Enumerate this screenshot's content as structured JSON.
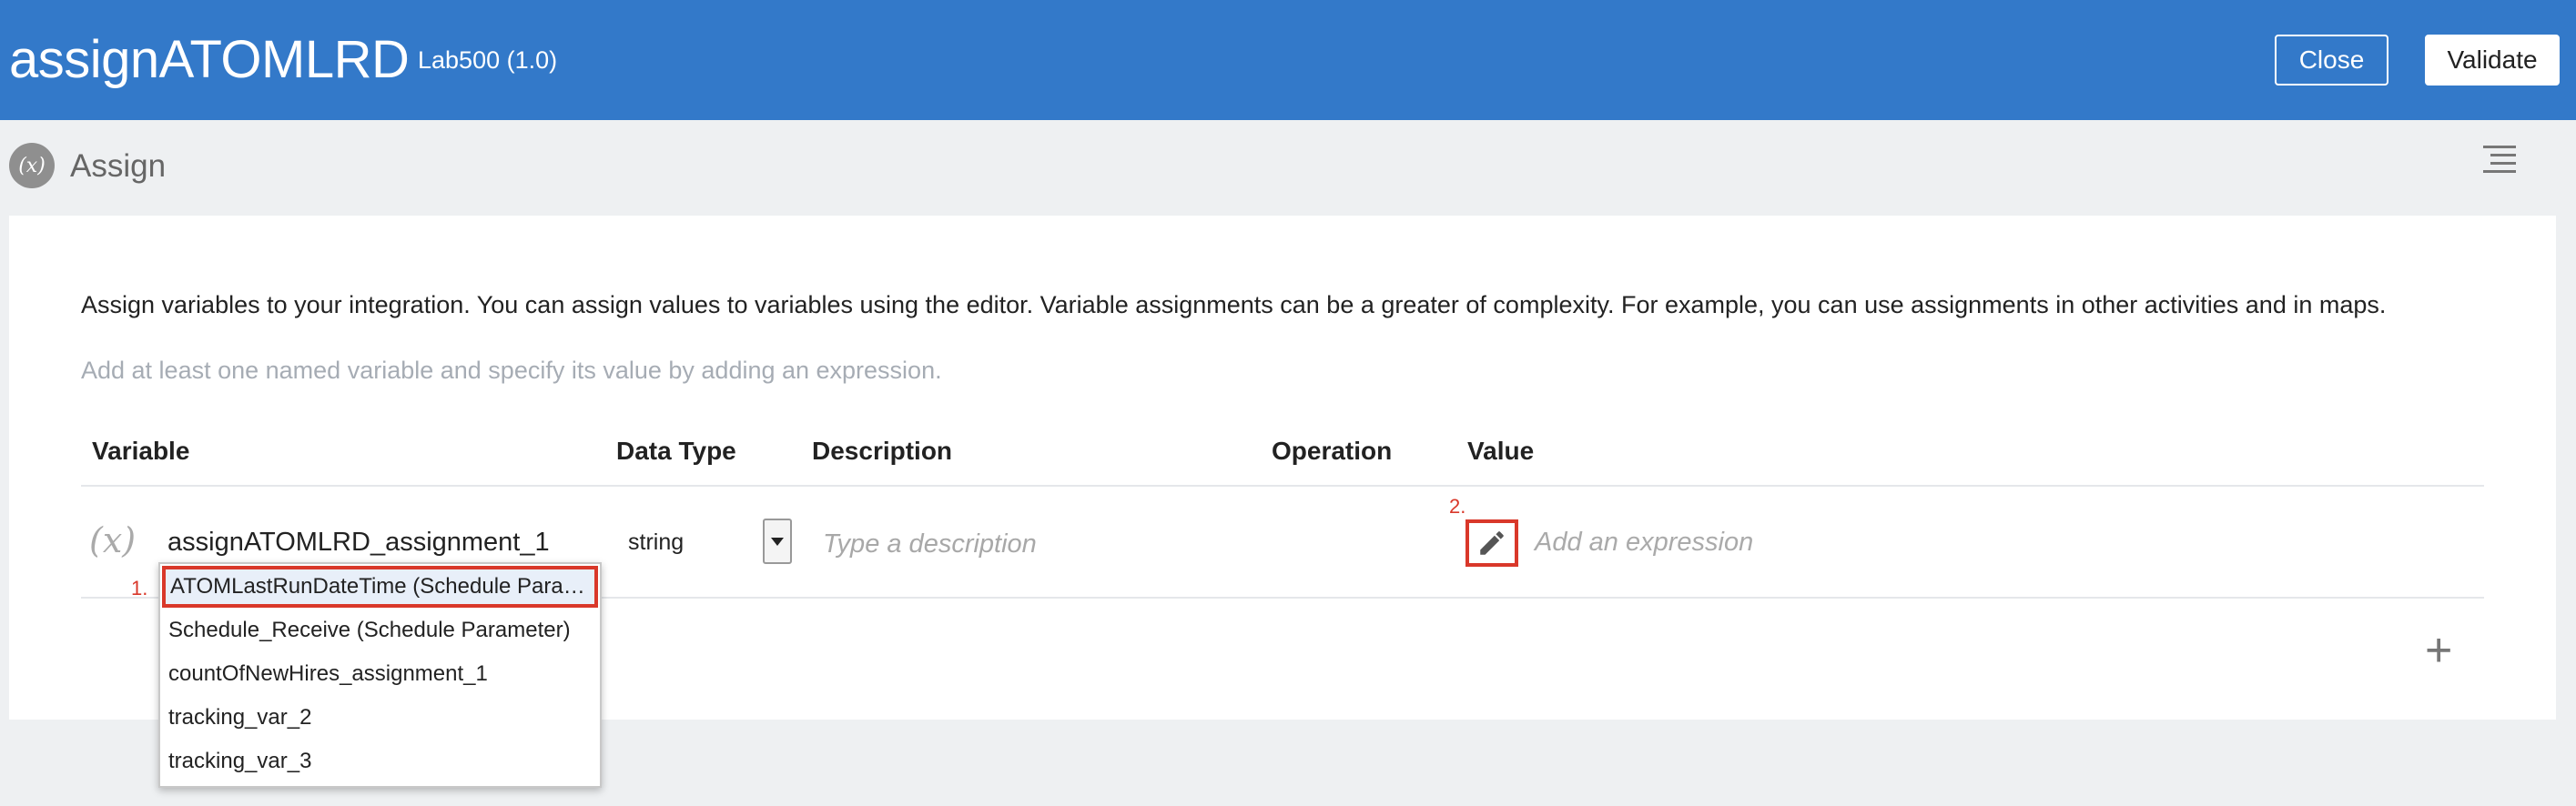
{
  "header": {
    "title": "assignATOMLRD",
    "subtitle": "Lab500 (1.0)",
    "close_label": "Close",
    "validate_label": "Validate",
    "bg_color": "#3379c9"
  },
  "subheader": {
    "icon_text": "(x)",
    "label": "Assign"
  },
  "intro": {
    "text": "Assign variables to your integration. You can assign values to variables using the editor. Variable assignments can be a greater of complexity. For example, you can use assignments in other activities and in maps.",
    "hint": "Add at least one named variable and specify its value by adding an expression."
  },
  "table": {
    "columns": [
      "Variable",
      "Data Type",
      "Description",
      "Operation",
      "Value"
    ],
    "row": {
      "icon_text": "(x)",
      "variable": "assignATOMLRD_assignment_1",
      "data_type": "string",
      "description_placeholder": "Type a description",
      "value_placeholder": "Add an expression"
    }
  },
  "dropdown": {
    "items": [
      "ATOMLastRunDateTime (Schedule Parameter)",
      "Schedule_Receive (Schedule Parameter)",
      "countOfNewHires_assignment_1",
      "tracking_var_2",
      "tracking_var_3"
    ],
    "selected_index": 0
  },
  "annotations": {
    "mark1": "1.",
    "mark2": "2.",
    "color": "#d9382a"
  },
  "icons": {
    "assign": "variable-icon",
    "menu": "hamburger-menu-icon",
    "edit": "pencil-icon",
    "add": "plus-icon"
  }
}
